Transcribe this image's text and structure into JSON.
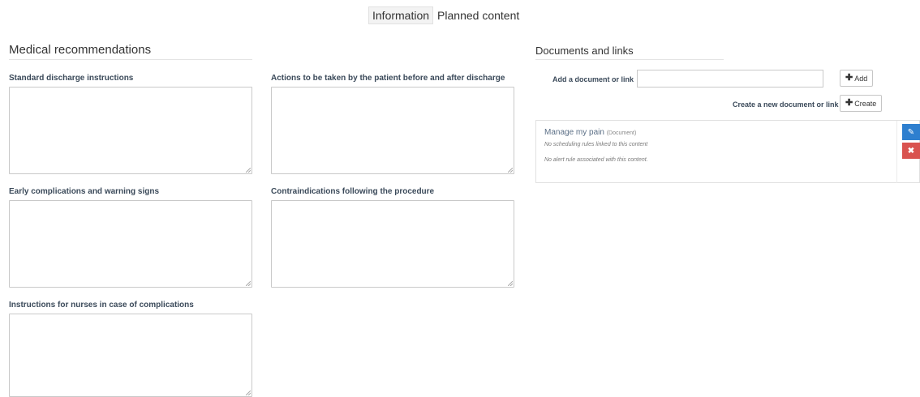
{
  "tabs": [
    {
      "label": "Information",
      "active": true
    },
    {
      "label": "Planned content",
      "active": false
    }
  ],
  "medical": {
    "title": "Medical recommendations",
    "fields": [
      {
        "label": "Standard discharge instructions",
        "value": ""
      },
      {
        "label": "Actions to be taken by the patient before and after discharge",
        "value": ""
      },
      {
        "label": "Early complications and warning signs",
        "value": ""
      },
      {
        "label": "Contraindications following the procedure",
        "value": ""
      },
      {
        "label": "Instructions for nurses in case of complications",
        "value": ""
      }
    ]
  },
  "documents": {
    "title": "Documents and links",
    "add_label": "Add a document or link",
    "add_input_value": "",
    "add_button": "Add",
    "create_label": "Create a new document or link",
    "create_button": "Create",
    "items": [
      {
        "name": "Manage my pain",
        "type": "(Document)",
        "scheduling": "No scheduling rules linked to this content",
        "alert": "No alert rule associated with this content."
      }
    ]
  },
  "colors": {
    "edit": "#2e7fcf",
    "delete": "#d9534f"
  },
  "icons": {
    "edit": "pencil-icon",
    "delete": "close-icon",
    "add": "plus-icon",
    "resize": "resize-grip-icon"
  }
}
